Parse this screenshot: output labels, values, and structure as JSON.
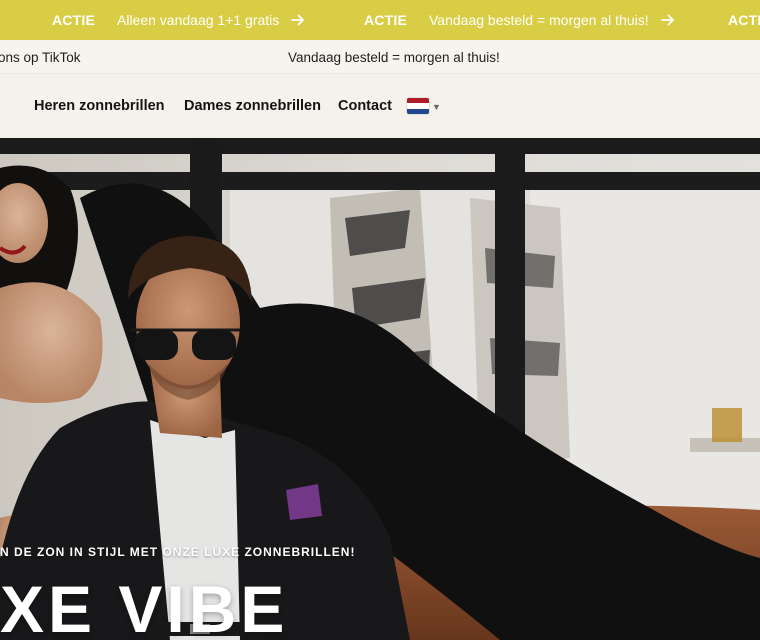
{
  "announcement_bar": {
    "items": [
      {
        "tag": "ACTIE",
        "text": "Alleen vandaag 1+1 gratis"
      },
      {
        "tag": "ACTIE",
        "text": "Vandaag besteld = morgen al thuis!"
      },
      {
        "tag": "ACTIE",
        "text": ""
      }
    ],
    "arrow_icon": "arrow-right-icon",
    "background_color": "#d8cd44"
  },
  "info_strip": {
    "left_text": "ons op TikTok",
    "center_text": "Vandaag besteld = morgen al thuis!"
  },
  "nav": {
    "links": [
      {
        "label": "Heren zonnebrillen"
      },
      {
        "label": "Dames zonnebrillen"
      },
      {
        "label": "Contact"
      }
    ],
    "language_flag": "netherlands-flag-icon",
    "flag_colors": [
      "#ae1c28",
      "#ffffff",
      "#21468b"
    ]
  },
  "hero": {
    "tagline": "N DE ZON IN STIJL MET ONZE LUXE ZONNEBRILLEN!",
    "title": "XE VIBE",
    "image": "hero-photo"
  }
}
